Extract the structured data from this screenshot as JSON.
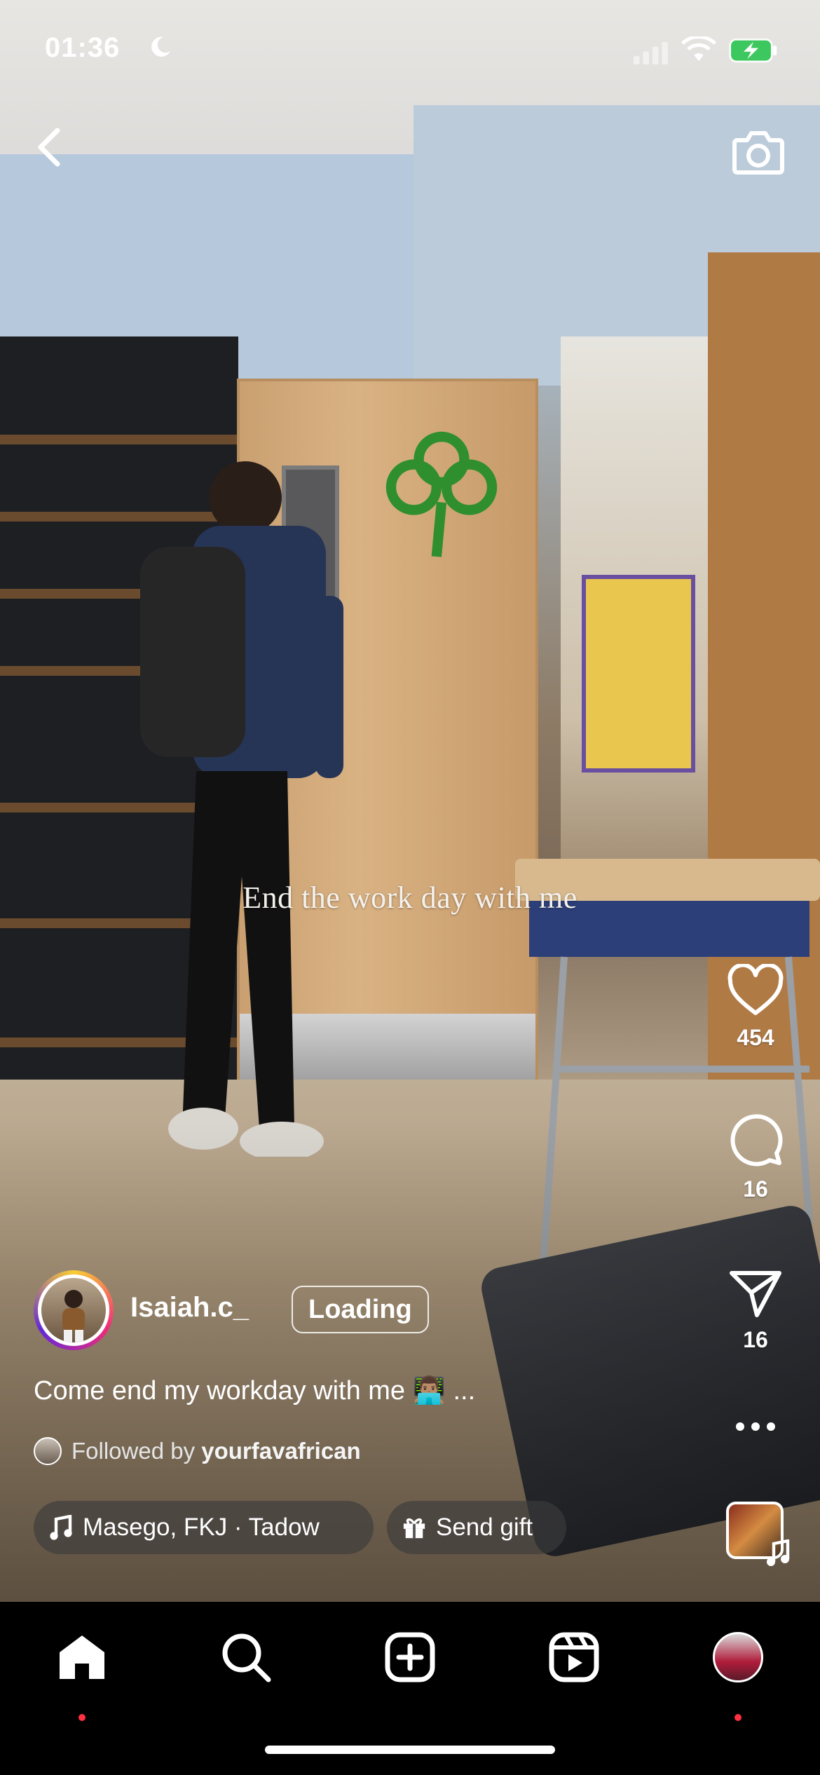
{
  "status_bar": {
    "time": "01:36"
  },
  "video": {
    "overlay_text": "End the work day with me"
  },
  "actions": {
    "likes": "454",
    "comments": "16",
    "shares": "16"
  },
  "author": {
    "username": "Isaiah.c_",
    "follow_button": "Loading",
    "caption": "Come end my workday with me 👨🏽‍💻 ...",
    "followed_prefix": "Followed by",
    "followed_user": "yourfavafrican"
  },
  "audio": {
    "label": "Masego, FKJ · Tadow"
  },
  "gift": {
    "label": "Send gift"
  },
  "nav": {
    "items": [
      "home-icon",
      "search-icon",
      "create-icon",
      "reels-icon",
      "profile-avatar"
    ]
  },
  "colors": {
    "notification_dot": "#ff3040",
    "background": "#000000"
  }
}
